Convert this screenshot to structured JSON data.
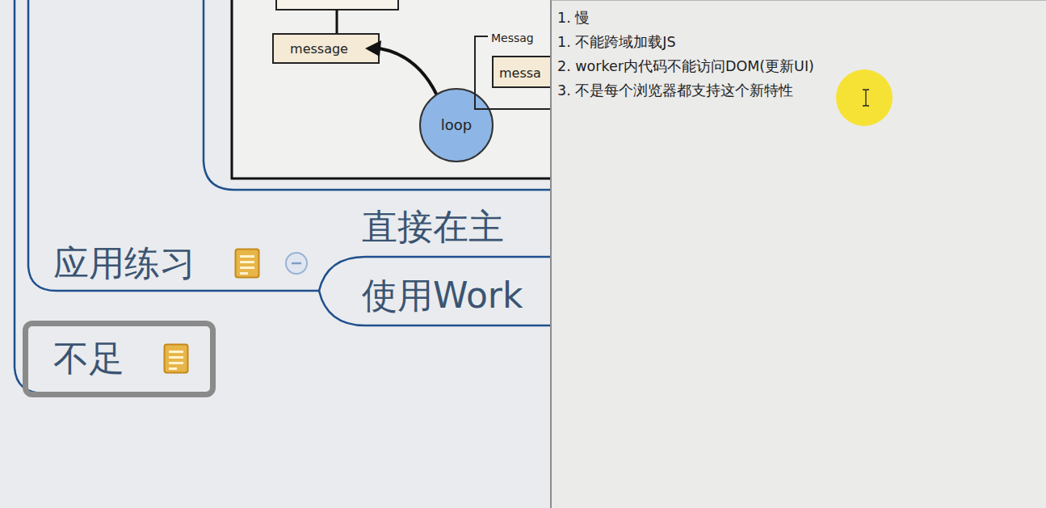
{
  "diagram": {
    "labels": {
      "message": "message",
      "loop": "loop",
      "queue_title": "Messag",
      "queue_item": "messa"
    }
  },
  "mindmap": {
    "nodes": [
      {
        "label": "应用练习",
        "has_note": true,
        "expanded": true,
        "selected": false,
        "children": [
          {
            "label": "直接在主"
          },
          {
            "label": "使用Work"
          }
        ]
      },
      {
        "label": "不足",
        "has_note": true,
        "selected": true
      }
    ]
  },
  "note": {
    "lines": [
      "1. 慢",
      "1. 不能跨域加载JS",
      "2. worker内代码不能访问DOM(更新UI)",
      "3. 不是每个浏览器都支持这个新特性"
    ]
  }
}
